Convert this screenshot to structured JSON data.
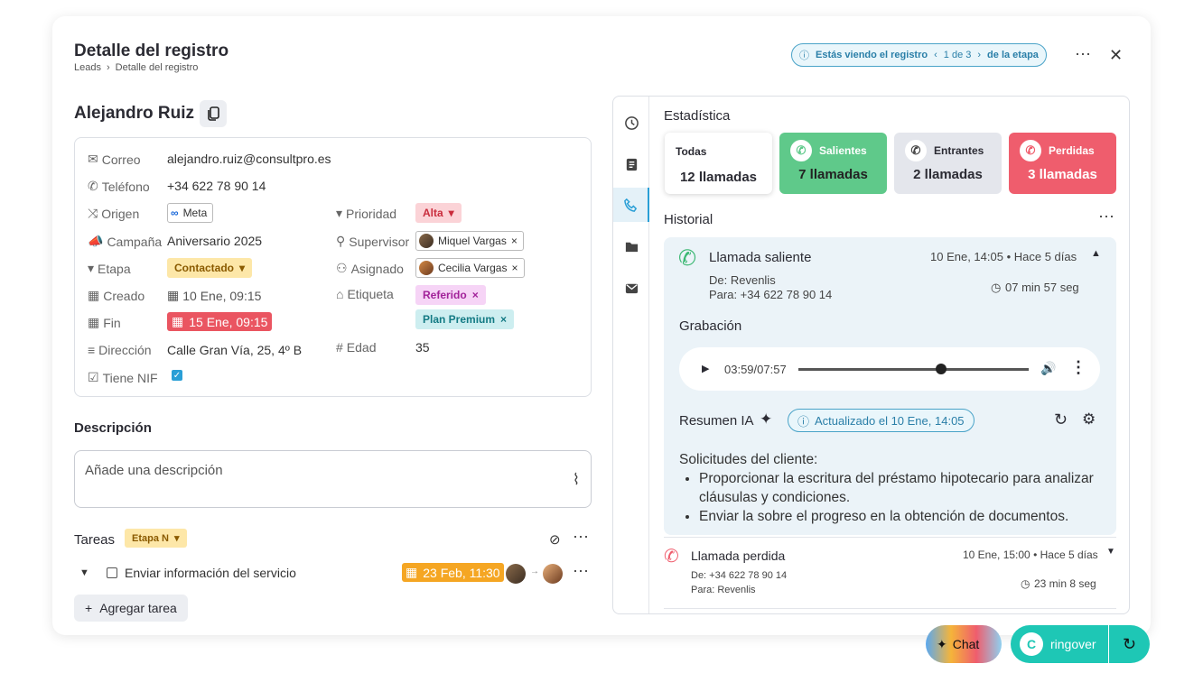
{
  "header": {
    "title": "Detalle del registro",
    "breadcrumb": [
      "Leads",
      "Detalle del registro"
    ],
    "view": {
      "prefix": "Estás viendo el registro",
      "pos": "1 de 3",
      "suffix": "de la etapa"
    }
  },
  "record": {
    "name": "Alejandro Ruiz"
  },
  "fields": {
    "correo": {
      "label": "Correo",
      "value": "alejandro.ruiz@consultpro.es"
    },
    "telefono": {
      "label": "Teléfono",
      "value": "+34 622 78 90 14"
    },
    "origen": {
      "label": "Origen",
      "value": "Meta"
    },
    "campana": {
      "label": "Campaña",
      "value": "Aniversario 2025"
    },
    "etapa": {
      "label": "Etapa",
      "value": "Contactado"
    },
    "creado": {
      "label": "Creado",
      "value": "10 Ene, 09:15"
    },
    "fin": {
      "label": "Fin",
      "value": "15 Ene, 09:15"
    },
    "direccion": {
      "label": "Dirección",
      "value": "Calle Gran Vía, 25, 4º B"
    },
    "nif": {
      "label": "Tiene NIF",
      "value": true
    },
    "prioridad": {
      "label": "Prioridad",
      "value": "Alta"
    },
    "supervisor": {
      "label": "Supervisor",
      "value": "Miquel Vargas"
    },
    "asignado": {
      "label": "Asignado",
      "value": "Cecilia Vargas"
    },
    "etiqueta": {
      "label": "Etiqueta",
      "values": [
        "Referido",
        "Plan Premium"
      ]
    },
    "edad": {
      "label": "Edad",
      "value": "35"
    }
  },
  "descripcion": {
    "title": "Descripción",
    "placeholder": "Añade una descripción"
  },
  "tareas": {
    "title": "Tareas",
    "stage": "Etapa N",
    "task": "Enviar información del servicio",
    "date": "23 Feb, 11:30",
    "add": "Agregar tarea"
  },
  "stats": {
    "title": "Estadística",
    "items": [
      {
        "label": "Todas",
        "value": "12 llamadas"
      },
      {
        "label": "Salientes",
        "value": "7 llamadas"
      },
      {
        "label": "Entrantes",
        "value": "2 llamadas"
      },
      {
        "label": "Perdidas",
        "value": "3 llamadas"
      }
    ]
  },
  "historial": {
    "title": "Historial",
    "call1": {
      "title": "Llamada saliente",
      "time": "10 Ene, 14:05 • Hace 5 días",
      "from": "De: Revenlis",
      "to": "Para: +34 622 78 90 14",
      "duration": "07 min 57 seg"
    },
    "grabacion": {
      "title": "Grabación",
      "time": "03:59/07:57",
      "progress": 0.62
    },
    "resumen": {
      "title": "Resumen IA",
      "updated": "Actualizado el 10 Ene, 14:05",
      "intro": "Solicitudes del cliente:",
      "bullets": [
        "Proporcionar la escritura del préstamo hipotecario para analizar cláusulas y condiciones.",
        "Enviar la sobre el progreso en la obtención de documentos."
      ]
    },
    "call2": {
      "title": "Llamada perdida",
      "time": "10 Ene, 15:00 • Hace 5 días",
      "from": "De: +34 622 78 90 14",
      "to": "Para: Revenlis",
      "duration": "23 min 8 seg"
    }
  },
  "footer": {
    "chat": "Chat",
    "brand": "ringover"
  },
  "colors": {
    "green": "#5fc98a",
    "red": "#ef5d6d",
    "teal": "#1ec7b5",
    "blue": "#2a7fa8"
  }
}
